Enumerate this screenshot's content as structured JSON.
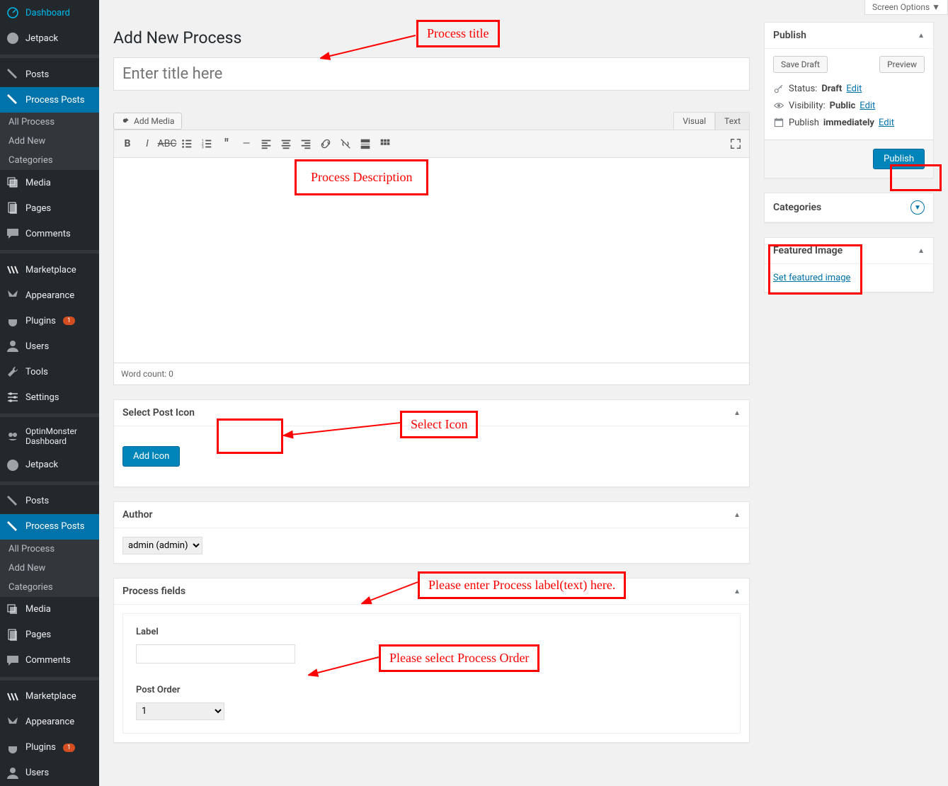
{
  "screen_options": "Screen Options ▼",
  "nav": {
    "dashboard": "Dashboard",
    "jetpack": "Jetpack",
    "posts": "Posts",
    "process_posts": "Process Posts",
    "all_process": "All Process",
    "add_new": "Add New",
    "categories": "Categories",
    "media": "Media",
    "pages": "Pages",
    "comments": "Comments",
    "marketplace": "Marketplace",
    "appearance": "Appearance",
    "plugins": "Plugins",
    "plugins_badge": "1",
    "users": "Users",
    "tools": "Tools",
    "settings": "Settings",
    "optinmonster": "OptinMonster Dashboard"
  },
  "page_title": "Add New Process",
  "title_placeholder": "Enter title here",
  "add_media": "Add Media",
  "tabs": {
    "visual": "Visual",
    "text": "Text"
  },
  "word_count": "Word count: 0",
  "select_icon_heading": "Select Post Icon",
  "add_icon": "Add Icon",
  "author_heading": "Author",
  "author_value": "admin (admin)",
  "process_fields_heading": "Process fields",
  "label_label": "Label",
  "post_order_label": "Post Order",
  "post_order_value": "1",
  "publish": {
    "title": "Publish",
    "save_draft": "Save Draft",
    "preview": "Preview",
    "status_label": "Status:",
    "status_value": "Draft",
    "edit": "Edit",
    "visibility_label": "Visibility:",
    "visibility_value": "Public",
    "publish_label": "Publish",
    "publish_value": "immediately",
    "submit": "Publish"
  },
  "categories_heading": "Categories",
  "featured_image": {
    "title": "Featured Image",
    "link": "Set featured image"
  },
  "annotations": {
    "process_title": "Process title",
    "process_description": "Process Description",
    "select_icon": "Select Icon",
    "process_label": "Please enter Process label(text) here.",
    "process_order": "Please select Process Order"
  }
}
